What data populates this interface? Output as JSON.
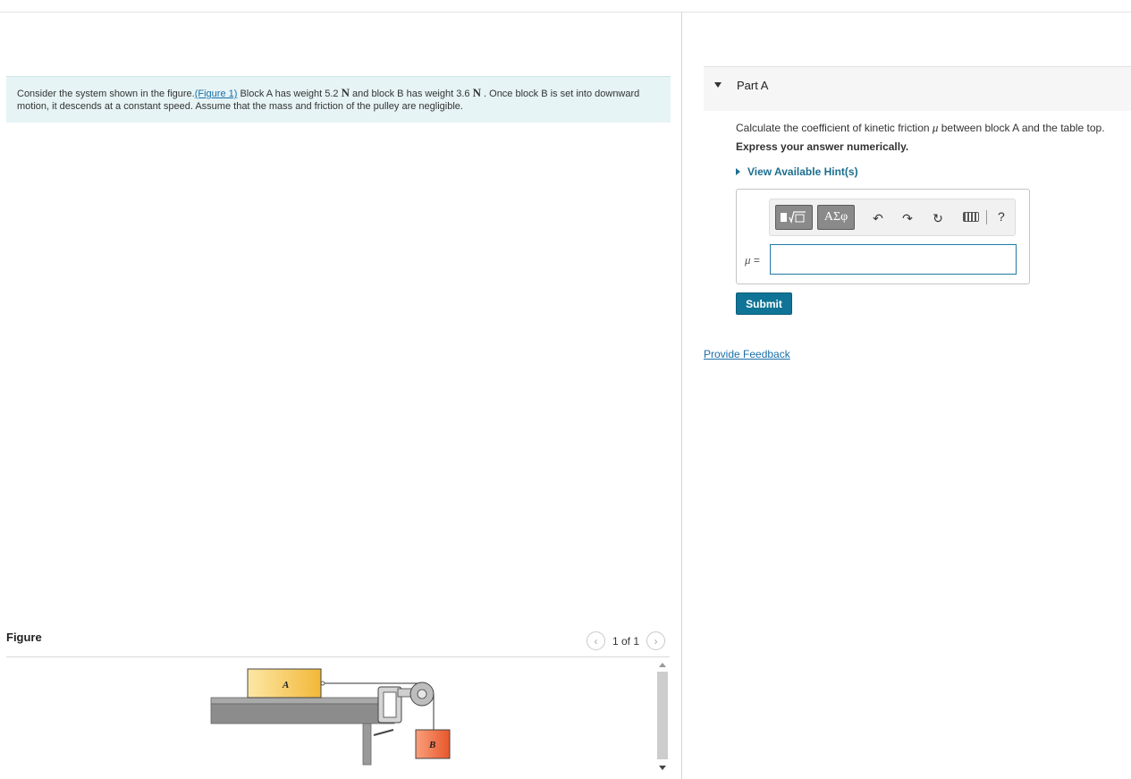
{
  "problem": {
    "text_before_link": "Consider the system shown in the figure.",
    "figure_link": "(Figure 1)",
    "text_a": " Block A has weight 5.2 ",
    "unit_a": "N",
    "text_b": " and block B has weight 3.6 ",
    "unit_b": "N",
    "text_c": " . Once block B is set into downward motion, it descends at a constant speed. Assume that the mass and friction of the pulley are negligible."
  },
  "figure": {
    "title": "Figure",
    "pager": "1 of 1",
    "prev_icon": "chevron-left-icon",
    "next_icon": "chevron-right-icon",
    "block_a_label": "A",
    "block_b_label": "B",
    "block_a_color": "#f7c74f",
    "block_b_color": "#f26a3c",
    "table_color": "#8c8c8c"
  },
  "part_a": {
    "title": "Part A",
    "question_before": "Calculate the coefficient of kinetic friction ",
    "question_symbol": "μ",
    "question_after": " between block A and the table top.",
    "instruction": "Express your answer numerically.",
    "hints_label": "View Available Hint(s)",
    "toolbar": {
      "template_icon": "templates-icon",
      "greek_label": "ΑΣφ",
      "undo_icon": "undo-icon",
      "redo_icon": "redo-icon",
      "reset_icon": "reset-icon",
      "keyboard_icon": "keyboard-icon",
      "help_label": "?"
    },
    "answer_label_symbol": "μ",
    "answer_label_eq": " =",
    "answer_value": "",
    "submit_label": "Submit"
  },
  "feedback_label": "Provide Feedback",
  "colors": {
    "accent": "#0f7495",
    "link": "#1a6fa8",
    "statement_bg": "#e7f4f5"
  }
}
